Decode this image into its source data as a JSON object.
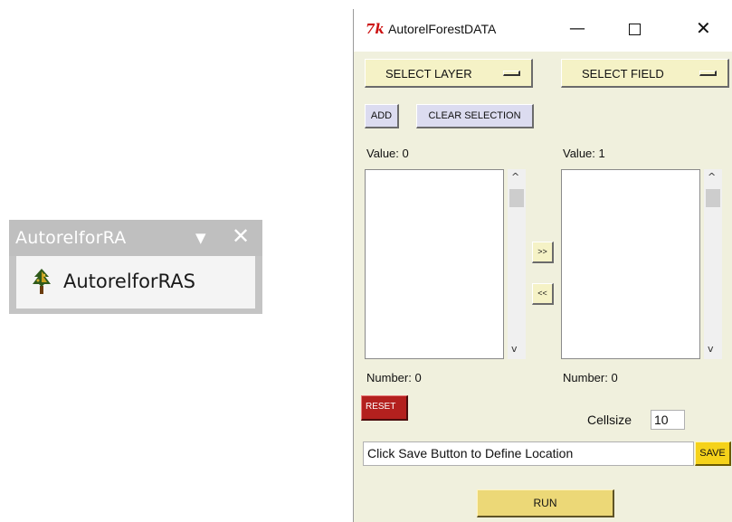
{
  "toolbar": {
    "title": "AutorelforRA",
    "dropdown_glyph": "▼",
    "close_glyph": "✕",
    "tool_label": "AutorelforRAS",
    "tool_icon": "tree-icon"
  },
  "window": {
    "logo": "7k",
    "title": "AutorelForestDATA",
    "minimize_glyph": "—",
    "close_glyph": "✕",
    "select_layer_label": "SELECT LAYER",
    "select_field_label": "SELECT FIELD",
    "add_label": "ADD",
    "clear_selection_label": "CLEAR SELECTION",
    "left_value_label": "Value: 0",
    "right_value_label": "Value: 1",
    "move_right_label": ">>",
    "move_left_label": "<<",
    "left_number_label": "Number: 0",
    "right_number_label": "Number: 0",
    "reset_label": "RESET",
    "cellsize_label": "Cellsize",
    "cellsize_value": "10",
    "location_text": "Click Save Button to Define Location",
    "save_label": "SAVE",
    "run_label": "RUN",
    "scroll_up_glyph": "^",
    "scroll_down_glyph": "v"
  },
  "colors": {
    "window_bg": "#f0f0dd",
    "reset_bg": "#b3201e",
    "save_bg": "#f5d21a",
    "run_bg": "#ecd877"
  }
}
